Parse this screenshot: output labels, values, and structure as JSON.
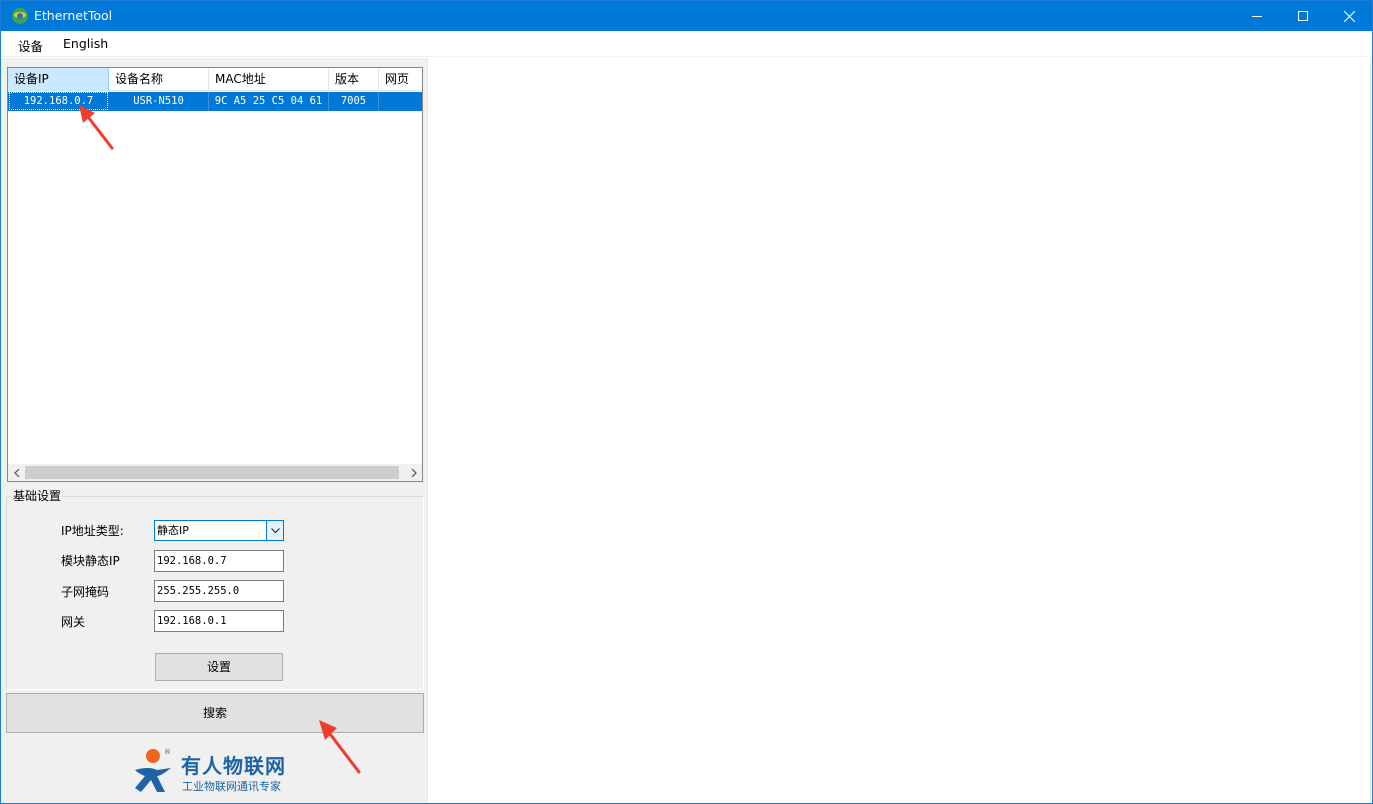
{
  "window": {
    "title": "EthernetTool"
  },
  "menu": {
    "items": [
      "设备",
      "English"
    ]
  },
  "device_list": {
    "columns": [
      "设备IP",
      "设备名称",
      "MAC地址",
      "版本",
      "网页"
    ],
    "rows": [
      {
        "ip": "192.168.0.7",
        "name": "USR-N510",
        "mac": "9C A5 25 C5 04 61",
        "version": "7005",
        "web": ""
      }
    ],
    "selected_row": 0
  },
  "basic_settings": {
    "title": "基础设置",
    "ip_type_label": "IP地址类型:",
    "ip_type_value": "静态IP",
    "static_ip_label": "模块静态IP",
    "static_ip_value": "192.168.0.7",
    "subnet_label": "子网掩码",
    "subnet_value": "255.255.255.0",
    "gateway_label": "网关",
    "gateway_value": "192.168.0.1",
    "set_button": "设置"
  },
  "search_button": "搜索",
  "logo": {
    "name": "有人物联网",
    "tagline": "工业物联网通讯专家",
    "reg": "®"
  },
  "colors": {
    "titlebar": "#0078d7",
    "selection": "#0078d7",
    "logo": "#1d63a8",
    "annotation": "#f03c2a"
  }
}
